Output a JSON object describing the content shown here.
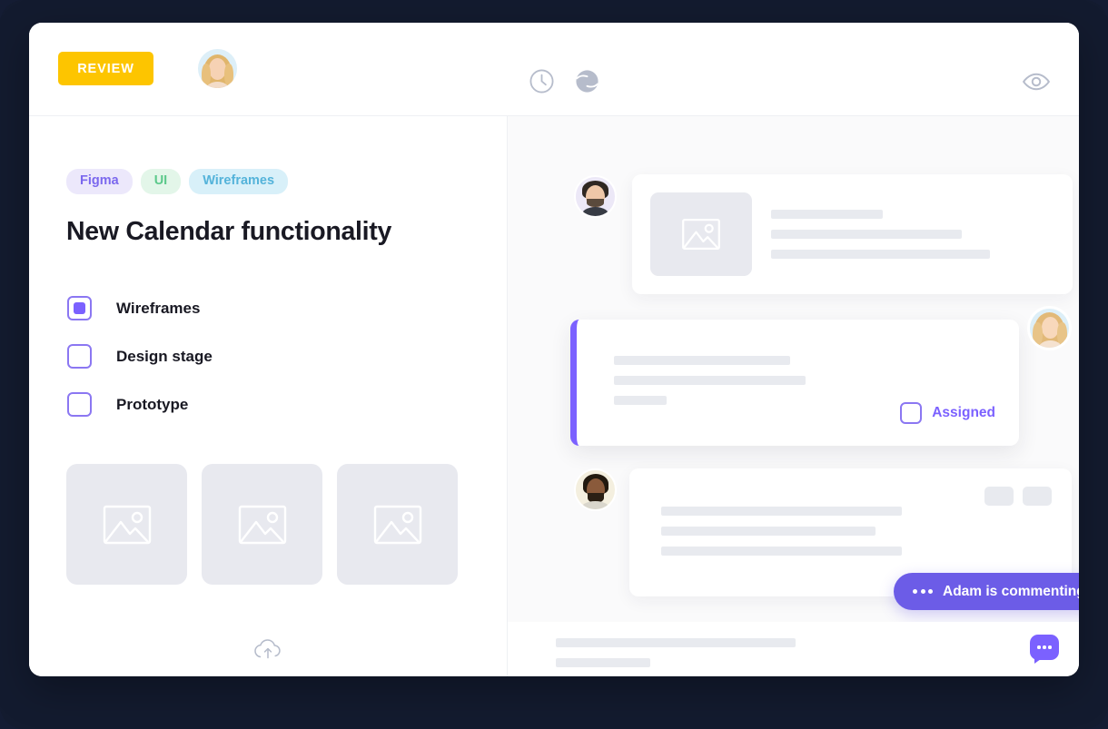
{
  "topbar": {
    "review_label": "REVIEW",
    "avatar_name": "user-avatar-blonde",
    "icons": [
      {
        "name": "clock-icon"
      },
      {
        "name": "contrast-sphere-icon"
      }
    ],
    "eye_icon": "eye-icon",
    "accent_yellow": "#fdc500"
  },
  "left_panel": {
    "tags": [
      {
        "label": "Figma",
        "bg": "#ece8fb",
        "fg": "#7b68ee"
      },
      {
        "label": "UI",
        "bg": "#e3f6e9",
        "fg": "#5cc98b"
      },
      {
        "label": "Wireframes",
        "bg": "#d8f0f9",
        "fg": "#54b3da"
      }
    ],
    "title": "New Calendar functionality",
    "checklist": [
      {
        "label": "Wireframes",
        "checked": true
      },
      {
        "label": "Design stage",
        "checked": false
      },
      {
        "label": "Prototype",
        "checked": false
      }
    ],
    "thumbnails": [
      {
        "name": "image-placeholder-1"
      },
      {
        "name": "image-placeholder-2"
      },
      {
        "name": "image-placeholder-3"
      }
    ]
  },
  "right_panel": {
    "cards": [
      {
        "name": "comment-card-one",
        "avatar_name": "commenter-avatar-one",
        "has_thumbnail": true,
        "skeleton_widths": [
          123,
          210,
          241
        ]
      },
      {
        "name": "assigned-card",
        "avatar_name": "commenter-avatar-two",
        "accent_color": "#7b61ff",
        "assigned_label": "Assigned",
        "assigned_checked": false,
        "skeleton_widths": [
          194,
          211,
          58
        ]
      },
      {
        "name": "comment-card-three",
        "avatar_name": "commenter-avatar-three",
        "mini_buttons": 2,
        "skeleton_widths": [
          265,
          236,
          265
        ]
      }
    ],
    "commenting_pill": {
      "text": "Adam is commenting",
      "color": "#6c5ce7"
    }
  },
  "bottombar": {
    "upload_icon": "cloud-upload-icon",
    "skeleton_widths": [
      264,
      104
    ],
    "comment_button_icon": "speech-bubble-icon",
    "comment_button_color": "#7b61ff"
  },
  "colors": {
    "page_background": "#131b2f",
    "window_background": "#ffffff",
    "right_panel_background": "#fafafb",
    "purple": "#7b61ff",
    "skeleton_gray": "#e8eaef",
    "placeholder_gray": "#e8e9ef"
  }
}
